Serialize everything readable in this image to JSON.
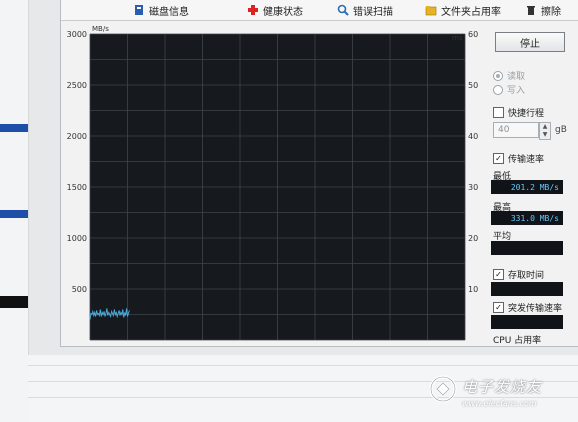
{
  "window": {
    "tabs": [
      {
        "label": "磁盘信息",
        "icon": "disk-info-icon"
      },
      {
        "label": "健康状态",
        "icon": "health-cross-icon"
      },
      {
        "label": "错误扫描",
        "icon": "magnifier-icon"
      },
      {
        "label": "文件夹占用率",
        "icon": "folder-icon"
      },
      {
        "label": "擦除",
        "icon": "trash-icon"
      }
    ]
  },
  "chart_data": {
    "type": "line",
    "y_left_label": "MB/s",
    "y_right_label": "ms",
    "y_left_ticks": [
      500,
      1000,
      1500,
      2000,
      2500,
      3000
    ],
    "y_right_ticks": [
      10,
      20,
      30,
      40,
      50,
      60
    ],
    "ylim": [
      0,
      3000
    ],
    "grid": true,
    "series": [
      {
        "color": "#4aa8d8",
        "x": [
          0,
          1,
          2,
          3,
          4,
          5,
          6,
          7,
          8,
          9,
          10,
          11,
          12,
          13,
          14,
          15,
          16,
          17,
          18,
          19,
          20,
          21,
          22,
          23,
          24,
          25,
          26,
          27,
          28,
          29,
          30,
          31,
          32,
          33,
          34,
          35,
          36,
          37,
          38,
          39,
          40,
          41,
          42
        ],
        "values": [
          200,
          260,
          250,
          280,
          240,
          270,
          230,
          290,
          250,
          260,
          240,
          300,
          230,
          270,
          250,
          280,
          230,
          260,
          310,
          240,
          270,
          250,
          230,
          280,
          260,
          240,
          300,
          250,
          270,
          230,
          260,
          290,
          240,
          270,
          250,
          300,
          220,
          270,
          240,
          310,
          230,
          260,
          290
        ]
      }
    ]
  },
  "panel": {
    "stop_button": "停止",
    "read_label": "读取",
    "write_label": "写入",
    "quick_stroke_label": "快捷行程",
    "quick_stroke_checked": false,
    "stroke_value": "40",
    "stroke_unit": "gB",
    "transfer_rate_label": "传输速率",
    "transfer_rate_checked": true,
    "min_label": "最低",
    "min_value": "201.2 MB/s",
    "max_label": "最高",
    "max_value": "331.0 MB/s",
    "avg_label": "平均",
    "avg_value": "",
    "access_time_label": "存取时间",
    "access_time_checked": true,
    "burst_rate_label": "突发传输速率",
    "burst_rate_checked": true,
    "cpu_label": "CPU 占用率"
  },
  "watermark": {
    "brand": "电子发烧友",
    "url": "www.elecfans.com"
  }
}
